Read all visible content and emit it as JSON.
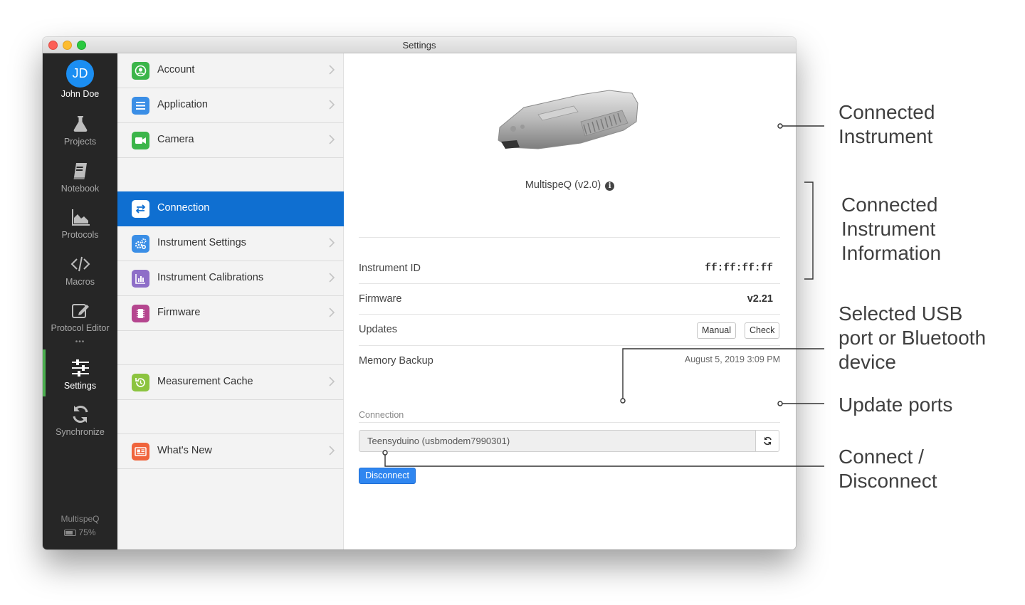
{
  "window": {
    "title": "Settings"
  },
  "sidebar": {
    "user": {
      "initials": "JD",
      "name": "John Doe"
    },
    "items": [
      {
        "label": "Projects",
        "icon": "flask-icon"
      },
      {
        "label": "Notebook",
        "icon": "notebook-icon"
      },
      {
        "label": "Protocols",
        "icon": "chart-area-icon"
      },
      {
        "label": "Macros",
        "icon": "code-icon"
      },
      {
        "label": "Protocol Editor",
        "icon": "edit-icon"
      },
      {
        "label": "Settings",
        "icon": "sliders-icon",
        "active": true
      },
      {
        "label": "Synchronize",
        "icon": "sync-icon"
      }
    ],
    "more": "•••",
    "device": {
      "name": "MultispeQ",
      "battery": "75%"
    }
  },
  "menu": {
    "items": [
      {
        "label": "Account",
        "color": "#3bb54a",
        "icon": "user-circle-icon"
      },
      {
        "label": "Application",
        "color": "#3a8ee6",
        "icon": "list-icon"
      },
      {
        "label": "Camera",
        "color": "#3bb54a",
        "icon": "video-camera-icon"
      },
      {
        "label": "Connection",
        "color": "#ffffff",
        "icon": "exchange-icon",
        "selected": true
      },
      {
        "label": "Instrument Settings",
        "color": "#3a8ee6",
        "icon": "gears-icon"
      },
      {
        "label": "Instrument Calibrations",
        "color": "#8e6ec8",
        "icon": "bar-chart-icon"
      },
      {
        "label": "Firmware",
        "color": "#b5468f",
        "icon": "chip-icon"
      },
      {
        "label": "Measurement Cache",
        "color": "#8cc43f",
        "icon": "history-icon"
      },
      {
        "label": "What's New",
        "color": "#f0643c",
        "icon": "newspaper-icon"
      }
    ]
  },
  "content": {
    "device_name": "MultispeQ (v2.0)",
    "info_glyph": "i",
    "rows": {
      "instrument_id": {
        "label": "Instrument ID",
        "value": "ff:ff:ff:ff"
      },
      "firmware": {
        "label": "Firmware",
        "value": "v2.21"
      },
      "updates": {
        "label": "Updates",
        "manual": "Manual",
        "check": "Check"
      },
      "memory_backup": {
        "label": "Memory Backup",
        "value": "August 5, 2019 3:09 PM"
      }
    },
    "connection": {
      "label": "Connection",
      "selected_port": "Teensyduino (usbmodem7990301)",
      "disconnect_label": "Disconnect"
    }
  },
  "annotations": {
    "connected_instrument": [
      "Connected",
      "Instrument"
    ],
    "instrument_information": [
      "Connected",
      "Instrument",
      "Information"
    ],
    "selected_port": [
      "Selected USB",
      "port or Bluetooth",
      "device"
    ],
    "update_ports": [
      "Update ports"
    ],
    "connect_disconnect": [
      "Connect /",
      "Disconnect"
    ]
  },
  "colors": {
    "accent": "#0f6fd1",
    "sidebar_bg": "#262626",
    "active_indicator": "#4caf50",
    "disconnect": "#2f86f0"
  }
}
